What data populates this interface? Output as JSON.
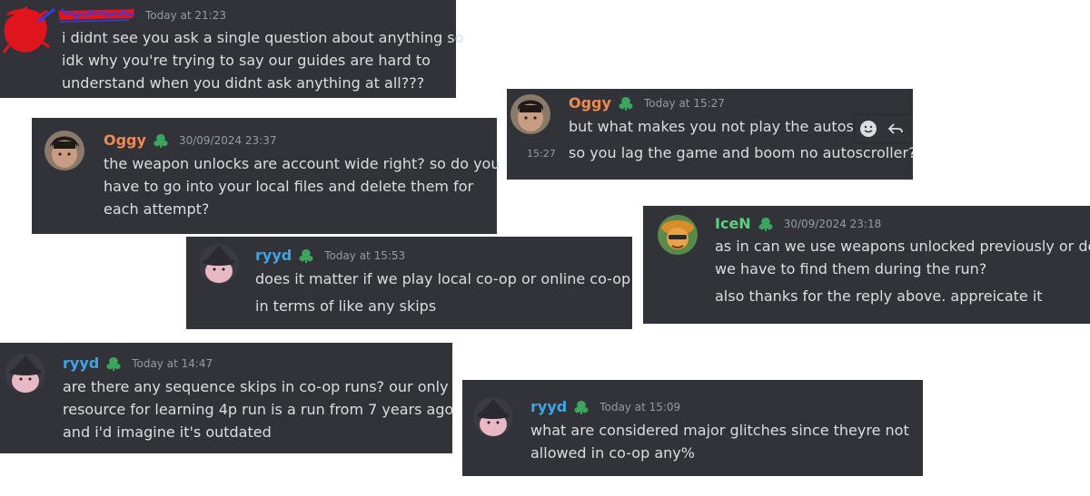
{
  "colors": {
    "card_bg": "#313338",
    "text": "#dbdee1",
    "timestamp": "#949ba4",
    "name_orange": "#f0894f",
    "name_blue": "#3ba5e8",
    "name_green": "#5bd081",
    "badge_green": "#3ba55d",
    "scribble_red": "#e0141c",
    "scribble_blue": "#2d3ff0"
  },
  "messages": [
    {
      "id": "m1",
      "author": "",
      "author_redacted": true,
      "timestamp": "Today at 21:23",
      "lines": [
        "i didnt see you ask a single question about anything so",
        "idk why you're trying to say our guides are hard to",
        "understand when you didnt ask anything at all???"
      ]
    },
    {
      "id": "m2",
      "author": "Oggy",
      "timestamp": "30/09/2024 23:37",
      "lines": [
        "the weapon unlocks are account wide right? so do you",
        "have to go into your local files and delete them for",
        "each attempt?"
      ]
    },
    {
      "id": "m3",
      "author": "Oggy",
      "timestamp": "Today at 15:27",
      "lines": [
        "but what makes you not play the autoscro",
        "so you lag the game and boom no autoscroller?"
      ],
      "hover_timestamp": "15:27"
    },
    {
      "id": "m4",
      "author": "IceN",
      "timestamp": "30/09/2024 23:18",
      "lines": [
        "as in can we use weapons unlocked previously or do",
        "we have to find them during the run?",
        "also thanks for the reply above. appreicate it"
      ]
    },
    {
      "id": "m5",
      "author": "ryyd",
      "timestamp": "Today at 15:53",
      "lines": [
        "does it matter if we play local co-op or online co-op",
        "in terms of like any skips"
      ]
    },
    {
      "id": "m6",
      "author": "ryyd",
      "timestamp": "Today at 14:47",
      "lines": [
        "are there any sequence skips in co-op runs? our only",
        "resource for learning 4p run is a run from 7 years ago",
        "and i'd imagine it's outdated"
      ]
    },
    {
      "id": "m7",
      "author": "ryyd",
      "timestamp": "Today at 15:09",
      "lines": [
        "what are considered major glitches since theyre not",
        "allowed in co-op any%"
      ]
    }
  ],
  "icons": {
    "badge": "guild-leaf-badge-icon",
    "add_reaction": "smiley-reaction-icon",
    "reply": "reply-arrow-icon"
  }
}
